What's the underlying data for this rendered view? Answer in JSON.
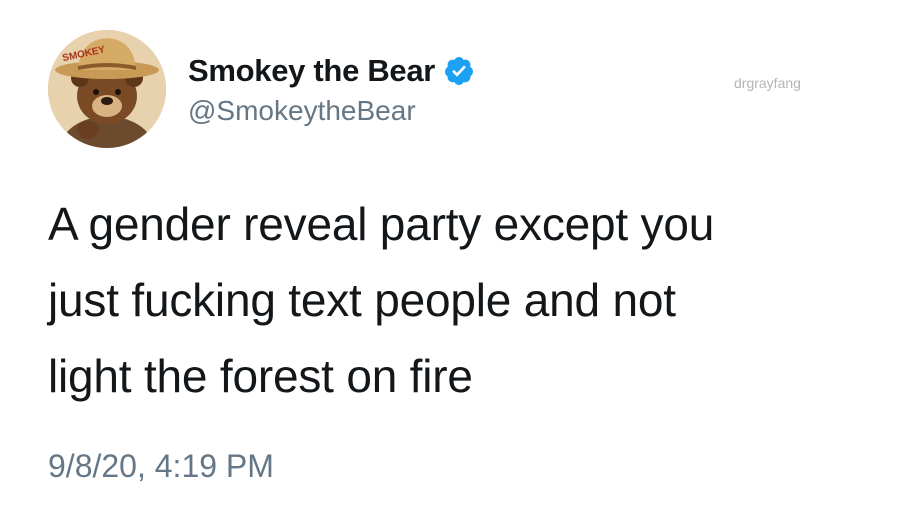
{
  "author": {
    "display_name": "Smokey the Bear",
    "handle": "@SmokeytheBear",
    "verified": true,
    "avatar_hat_text": "SMOKEY"
  },
  "watermark": "drgrayfang",
  "tweet": {
    "lines": [
      "A gender reveal party except you",
      "just fucking text people and not",
      "light the forest on fire"
    ]
  },
  "timestamp": "9/8/20, 4:19 PM",
  "colors": {
    "text": "#14171a",
    "secondary_text": "#657786",
    "verified_blue": "#1da1f2"
  }
}
